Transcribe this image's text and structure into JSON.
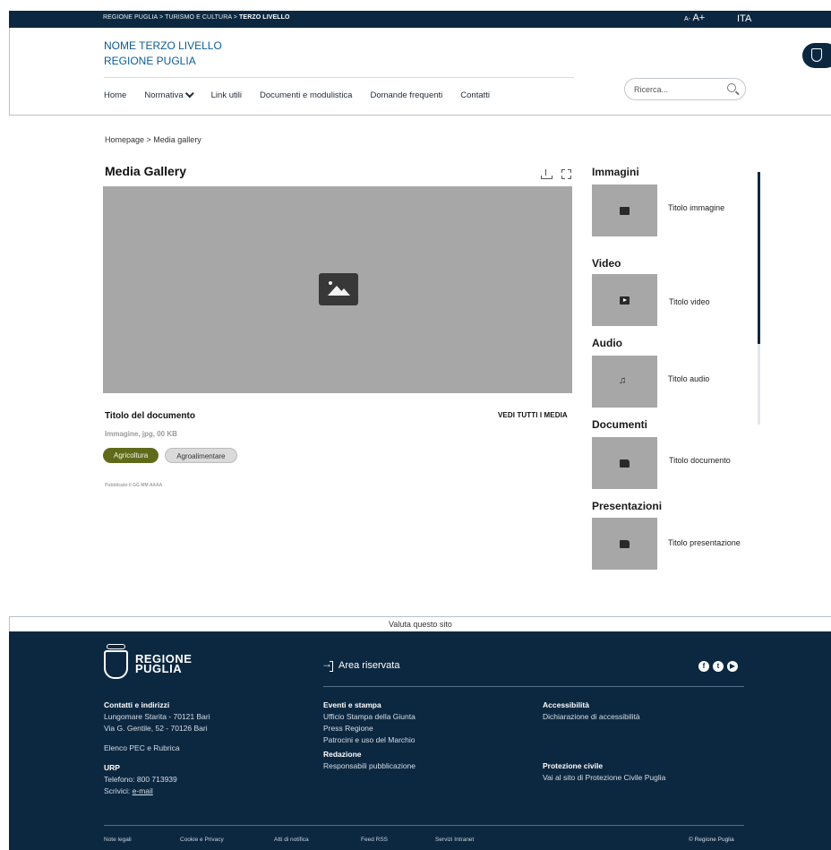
{
  "topbar": {
    "breadcrumb_prefix": "REGIONE PUGLIA > TURISMO E CULTURA > ",
    "breadcrumb_current": "TERZO LIVELLO",
    "font_decrease": "A-",
    "font_increase": "A+",
    "language": "ITA"
  },
  "header": {
    "site_name_line1": "NOME TERZO LIVELLO",
    "site_name_line2": "REGIONE PUGLIA",
    "nav": [
      "Home",
      "Normativa",
      "Link utili",
      "Documenti e modulistica",
      "Domande frequenti",
      "Contatti"
    ],
    "search_placeholder": "Ricerca..."
  },
  "breadcrumb": "Homepage  >  Media gallery",
  "gallery": {
    "title": "Media Gallery",
    "document_title": "Titolo del documento",
    "see_all": "VEDI TUTTI I MEDIA",
    "meta": "Immagine, jpg, 00 KB",
    "tags": [
      "Agricoltura",
      "Agroalimentare"
    ],
    "published": "Pubblicato il GG MM AAAA"
  },
  "side": [
    {
      "heading": "Immagini",
      "label": "Titolo immagine",
      "icon": "image-icon"
    },
    {
      "heading": "Video",
      "label": "Titolo video",
      "icon": "play-icon"
    },
    {
      "heading": "Audio",
      "label": "Titolo audio",
      "icon": "music-note-icon"
    },
    {
      "heading": "Documenti",
      "label": "Titolo documento",
      "icon": "document-icon"
    },
    {
      "heading": "Presentazioni",
      "label": "Titolo presentazione",
      "icon": "presentation-icon"
    }
  ],
  "footer": {
    "rate": "Valuta questo sito",
    "logo_line1": "REGIONE",
    "logo_line2": "PUGLIA",
    "reserved_area": "Area riservata",
    "contacts_heading": "Contatti e indirizzi",
    "address1": "Lungomare Starita - 70121 Bari",
    "address2": "Via G. Gentile, 52 - 70126 Bari",
    "pec": "Elenco PEC e Rubrica",
    "urp_heading": "URP",
    "phone": "Telefono: 800 713939",
    "write_prefix": "Scrivici: ",
    "email": "e-mail",
    "events_heading": "Eventi e stampa",
    "events_items": [
      "Ufficio Stampa della Giunta",
      "Press Regione",
      "Patrocini e uso del Marchio"
    ],
    "editorial_heading": "Redazione",
    "editorial_item": "Responsabili pubblicazione",
    "access_heading": "Accessibilità",
    "access_item": "Dichiarazione di accessibilità",
    "civil_heading": "Protezione civile",
    "civil_item": "Vai al sito di Protezione Civile Puglia",
    "bottom_links": [
      "Note legali",
      "Cookie e Privacy",
      "Atti di notifica",
      "Feed RSS",
      "Servizi Intranet"
    ],
    "copyright": "© Regione Puglia"
  }
}
